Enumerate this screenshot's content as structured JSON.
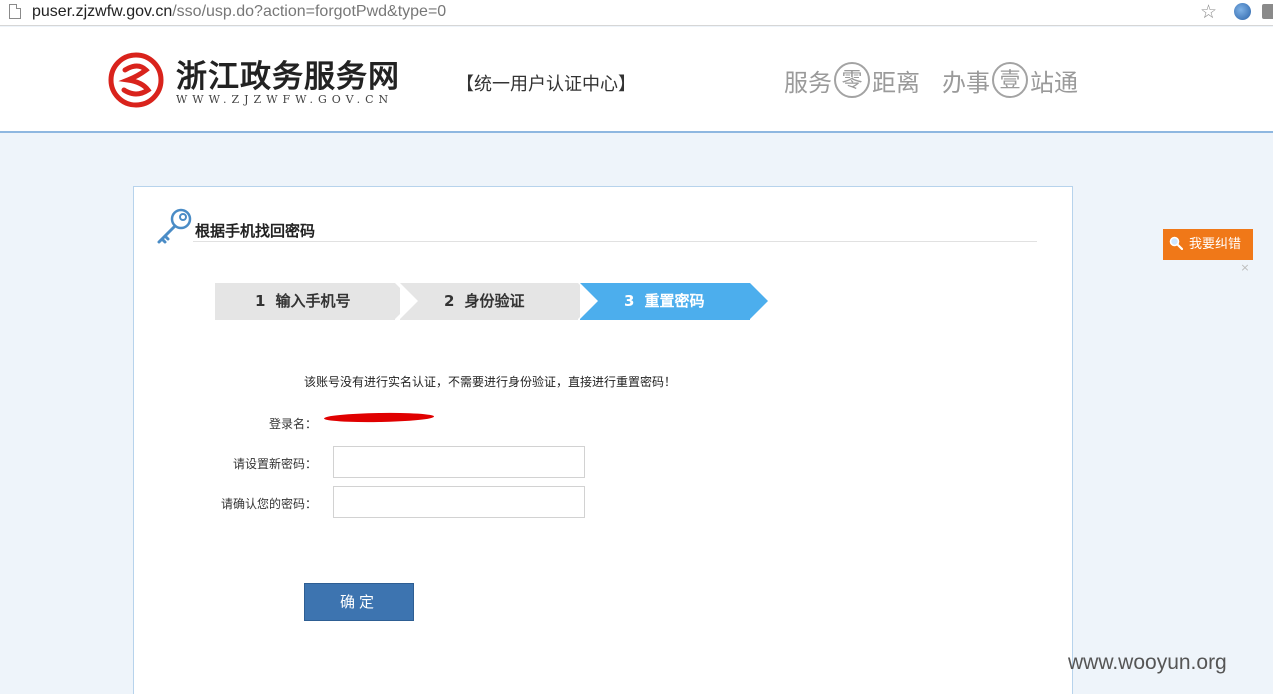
{
  "browser": {
    "url_host": "puser.zjzwfw.gov.cn",
    "url_path": "/sso/usp.do?action=forgotPwd&type=0"
  },
  "header": {
    "site_title": "浙江政务服务网",
    "site_url": "WWW.ZJZWFW.GOV.CN",
    "center_name": "【统一用户认证中心】",
    "slogan": {
      "part1_a": "服务",
      "part1_circle": "零",
      "part1_b": "距离",
      "part2_a": "办事",
      "part2_circle": "壹",
      "part2_b": "站通"
    }
  },
  "panel": {
    "title": "根据手机找回密码",
    "steps": [
      {
        "num": "1",
        "label": "输入手机号",
        "active": false
      },
      {
        "num": "2",
        "label": "身份验证",
        "active": false
      },
      {
        "num": "3",
        "label": "重置密码",
        "active": true
      }
    ],
    "notice": "该账号没有进行实名认证，不需要进行身份验证，直接进行重置密码！",
    "login_label": "登录名：",
    "new_pwd_label": "请设置新密码：",
    "confirm_pwd_label": "请确认您的密码：",
    "new_pwd_value": "",
    "confirm_pwd_value": "",
    "submit_label": "确定"
  },
  "feedback": {
    "label": "我要纠错",
    "close": "×"
  },
  "watermark": "www.wooyun.org",
  "colors": {
    "step_active": "#4caeed",
    "step_inactive": "#e5e5e5",
    "submit": "#3d74b0",
    "feedback": "#f07818",
    "logo_red": "#d9231c"
  }
}
